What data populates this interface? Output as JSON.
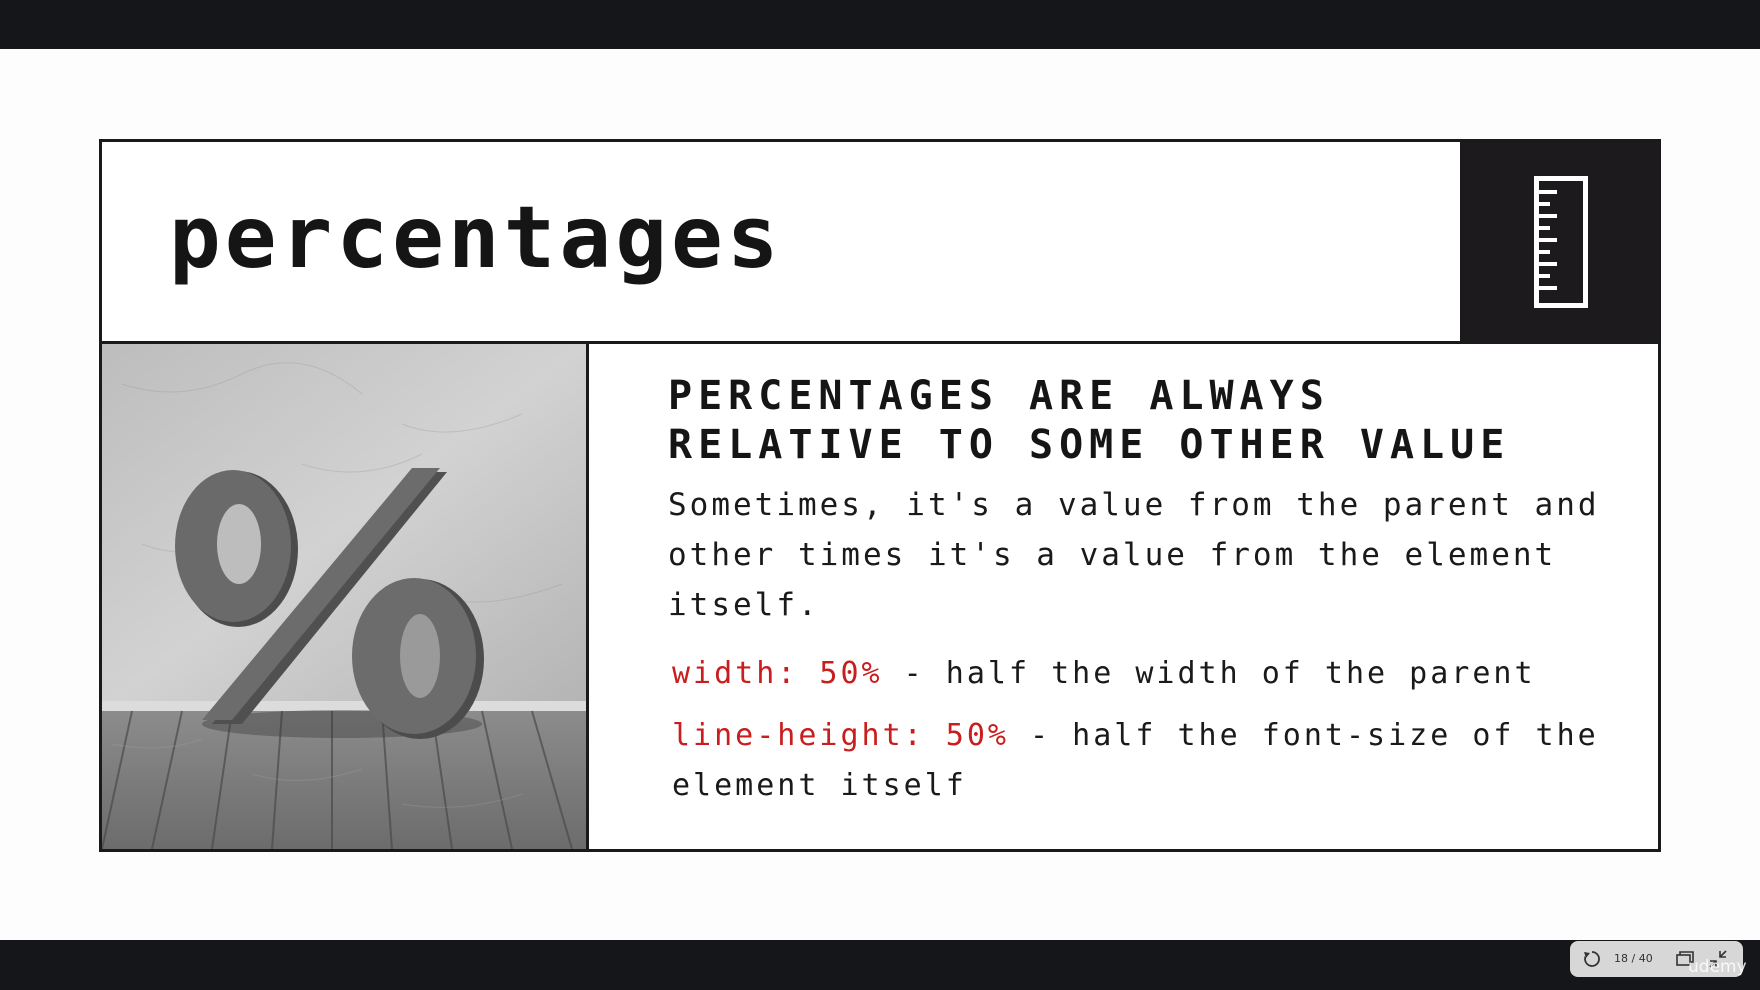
{
  "slide": {
    "title": "percentages",
    "icon": "ruler-icon",
    "image": {
      "description_icon": "percent-sign-illustration"
    },
    "headline_line1": "PERCENTAGES ARE ALWAYS",
    "headline_line2": "RELATIVE TO SOME OTHER VALUE",
    "body": "Sometimes, it's a value from the parent and other times it's a value from the element itself.",
    "examples": [
      {
        "code": "width: 50%",
        "description": " - half the width of the parent"
      },
      {
        "code": "line-height: 50%",
        "description": " - half the font-size of the element itself"
      }
    ]
  },
  "player": {
    "page_counter": "18 / 40",
    "brand": "udemy"
  },
  "colors": {
    "frame_dark": "#1c1a1d",
    "code_red": "#c81e1e",
    "letterbox": "#141619"
  }
}
